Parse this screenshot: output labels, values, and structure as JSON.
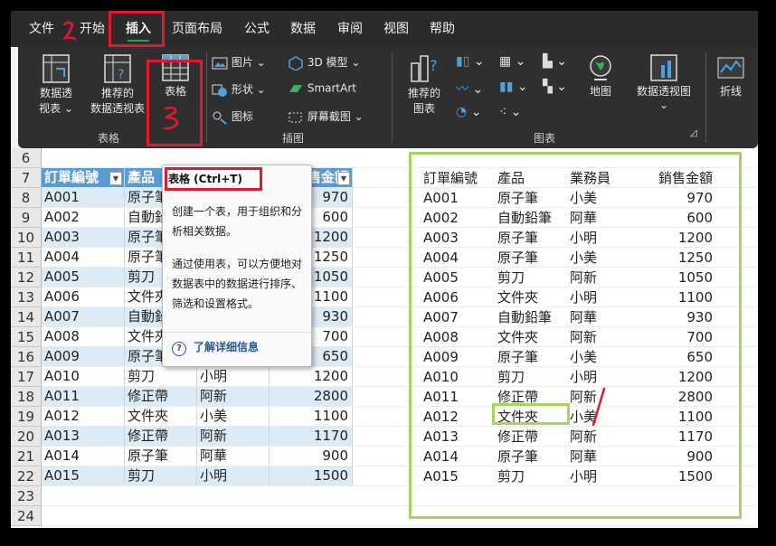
{
  "menu": [
    "文件",
    "开始",
    "插入",
    "页面布局",
    "公式",
    "数据",
    "审阅",
    "视图",
    "帮助"
  ],
  "ribbon": {
    "pivot": "数据透\n视表",
    "pivot_l1": "数据透",
    "pivot_l2": "视表",
    "rec_pivot_l1": "推荐的",
    "rec_pivot_l2": "数据透视表",
    "table": "表格",
    "group_table": "表格",
    "pictures": "图片",
    "shapes": "形状",
    "icons": "图标",
    "model3d": "3D 模型",
    "smartart": "SmartArt",
    "screenshot": "屏幕截图",
    "group_illustrations": "插图",
    "rec_charts_l1": "推荐的",
    "rec_charts_l2": "图表",
    "maps": "地图",
    "pivot_chart": "数据透视图",
    "group_charts": "图表",
    "sparkline": "折线"
  },
  "tooltip": {
    "title": "表格 (Ctrl+T)",
    "body1": "创建一个表，用于组织和分析相关数据。",
    "body2": "通过使用表，可以方便地对数据表中的数据进行排序、筛选和设置格式。",
    "link": "了解详细信息"
  },
  "rows": [
    "6",
    "7",
    "8",
    "9",
    "10",
    "11",
    "12",
    "13",
    "14",
    "15",
    "16",
    "17",
    "18",
    "19",
    "20",
    "21",
    "22",
    "23",
    "24"
  ],
  "table_headers": [
    "訂單編號",
    "產品",
    "業務員",
    "銷售金額"
  ],
  "records": [
    [
      "A001",
      "原子筆",
      "小美",
      "970"
    ],
    [
      "A002",
      "自動鉛筆",
      "阿華",
      "600"
    ],
    [
      "A003",
      "原子筆",
      "小明",
      "1200"
    ],
    [
      "A004",
      "原子筆",
      "小美",
      "1250"
    ],
    [
      "A005",
      "剪刀",
      "阿新",
      "1050"
    ],
    [
      "A006",
      "文件夾",
      "小明",
      "1100"
    ],
    [
      "A007",
      "自動鉛筆",
      "阿華",
      "930"
    ],
    [
      "A008",
      "文件夾",
      "阿新",
      "700"
    ],
    [
      "A009",
      "原子筆",
      "小美",
      "650"
    ],
    [
      "A010",
      "剪刀",
      "小明",
      "1200"
    ],
    [
      "A011",
      "修正帶",
      "阿新",
      "2800"
    ],
    [
      "A012",
      "文件夾",
      "小美",
      "1100"
    ],
    [
      "A013",
      "修正帶",
      "阿新",
      "1170"
    ],
    [
      "A014",
      "原子筆",
      "阿華",
      "900"
    ],
    [
      "A015",
      "剪刀",
      "小明",
      "1500"
    ]
  ],
  "colors": {
    "accent_green": "#21a366",
    "highlight_red": "#e0192c",
    "lime": "#a4d65e",
    "table_header": "#5b9bd5",
    "band": "#ddebf7"
  }
}
